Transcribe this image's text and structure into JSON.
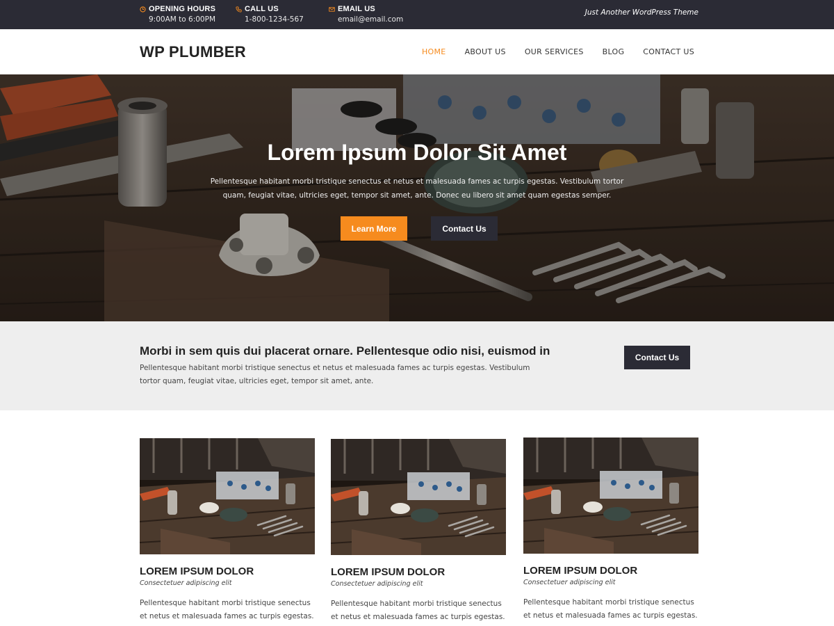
{
  "topbar": {
    "hours_title": "OPENING HOURS",
    "hours_value": "9:00AM to 6:00PM",
    "call_title": "CALL US",
    "call_value": "1-800-1234-567",
    "email_title": "EMAIL US",
    "email_value": "email@email.com",
    "tagline": "Just Another WordPress Theme",
    "icons": [
      "clock-icon",
      "phone-icon",
      "envelope-icon"
    ]
  },
  "header": {
    "logo": "WP PLUMBER",
    "nav": [
      "HOME",
      "ABOUT US",
      "OUR SERVICES",
      "BLOG",
      "CONTACT US"
    ],
    "active_nav": "HOME"
  },
  "hero": {
    "title": "Lorem Ipsum Dolor Sit Amet",
    "text": "Pellentesque habitant morbi tristique senectus et netus et malesuada fames ac turpis egestas. Vestibulum tortor quam, feugiat vitae, ultricies eget, tempor sit amet, ante. Donec eu libero sit amet quam egestas semper.",
    "primary_button": "Learn More",
    "secondary_button": "Contact Us"
  },
  "cta": {
    "title": "Morbi in sem quis dui placerat ornare. Pellentesque odio nisi, euismod in",
    "text": "Pellentesque habitant morbi tristique senectus et netus et malesuada fames ac turpis egestas. Vestibulum tortor quam, feugiat vitae, ultricies eget, tempor sit amet, ante.",
    "button": "Contact Us"
  },
  "cards": [
    {
      "title": "LOREM IPSUM DOLOR",
      "subtitle": "Consectetuer adipiscing elit",
      "text": "Pellentesque habitant morbi tristique senectus et netus et malesuada fames ac turpis egestas."
    },
    {
      "title": "LOREM IPSUM DOLOR",
      "subtitle": "Consectetuer adipiscing elit",
      "text": "Pellentesque habitant morbi tristique senectus et netus et malesuada fames ac turpis egestas."
    },
    {
      "title": "LOREM IPSUM DOLOR",
      "subtitle": "Consectetuer adipiscing elit",
      "text": "Pellentesque habitant morbi tristique senectus et netus et malesuada fames ac turpis egestas."
    }
  ],
  "colors": {
    "accent": "#f68b1e",
    "dark": "#2b2b35",
    "band": "#eeeeee"
  }
}
